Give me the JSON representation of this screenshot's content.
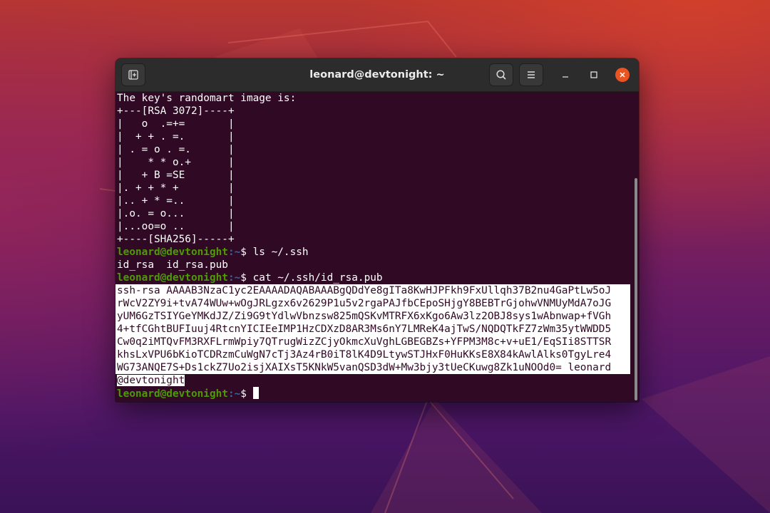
{
  "window": {
    "title": "leonard@devtonight: ~"
  },
  "prompt": {
    "user_host": "leonard@devtonight",
    "path": ":~",
    "symbol": "$"
  },
  "terminal": {
    "randomart_lines": [
      "The key's randomart image is:",
      "+---[RSA 3072]----+",
      "|   o  .=+=       |",
      "|  + + . =.       |",
      "| . = o . =.      |",
      "|    * * o.+      |",
      "|   + B =SE       |",
      "|. + + * +        |",
      "|.. + * =..       |",
      "|.o. = o...       |",
      "|...oo=o ..       |",
      "+----[SHA256]-----+"
    ],
    "cmd1": " ls ~/.ssh",
    "ls_output": "id_rsa  id_rsa.pub",
    "cmd2": " cat ~/.ssh/id_rsa.pub",
    "pubkey_lines": [
      "ssh-rsa AAAAB3NzaC1yc2EAAAADAQABAAABgQDdYe8gITa8KwHJPFkh9FxUllqh37B2nu4GaPtLw5oJ",
      "rWcV2ZY9i+tvA74WUw+wOgJRLgzx6v2629P1u5v2rgaPAJfbCEpoSHjgY8BEBTrGjohwVNMUyMdA7oJG",
      "yUM6GzTSIYGeYMKdJZ/Zi9G9tYdlwVbnzsw825mQSKvMTRFX6xKgo6Aw3lz2OBJ8sys1wAbnwap+fVGh",
      "4+tfCGhtBUFIuuj4RtcnYICIEeIMP1HzCDXzD8AR3Ms6nY7LMReK4ajTwS/NQDQTkFZ7zWm35ytWWDD5",
      "Cw0q2iMTQvFM3RXFLrmWpiy7QTrugWizZCjyOkmcXuVghLGBEGBZs+YFPM3M8c+v+uE1/EqSIi8STTSR",
      "khsLxVPU6bKioTCDRzmCuWgN7cTj3Az4rB0iT8lK4D9LtywSTJHxF0HuKKsE8X84kAwlAlks0TgyLre4",
      "WG73ANQE7S+Ds1ckZ7Uo2isjXAIXsT5KNkW5vanQSD3dW+Mw3bjy3tUeCKuwg8Zk1uNOOd0= leonard"
    ],
    "pubkey_last": "@devtonight"
  }
}
